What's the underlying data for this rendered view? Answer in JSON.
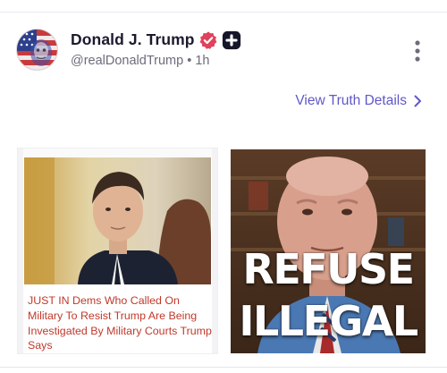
{
  "author": {
    "name": "Donald J. Trump",
    "handle": "@realDonaldTrump",
    "separator": "•",
    "time": "1h"
  },
  "post": {
    "view_details_label": "View Truth Details"
  },
  "media": [
    {
      "kind": "article-card",
      "headline": "JUST IN Dems Who Called On Military To Resist Trump Are Being Investigated By Military Courts Trump Says"
    },
    {
      "kind": "image",
      "overlay_line_1": "REFUSE",
      "overlay_line_2": "ILLEGAL"
    }
  ],
  "icons": {
    "verified": "verified-check-badge",
    "plus": "plus-badge",
    "menu": "vertical-ellipsis",
    "chevron": "chevron-right"
  },
  "colors": {
    "name_text": "#1b1b2e",
    "meta_text": "#6c6c7e",
    "link": "#5f58c9",
    "verified_badge": "#e0415c",
    "headline_text": "#c0392b"
  }
}
